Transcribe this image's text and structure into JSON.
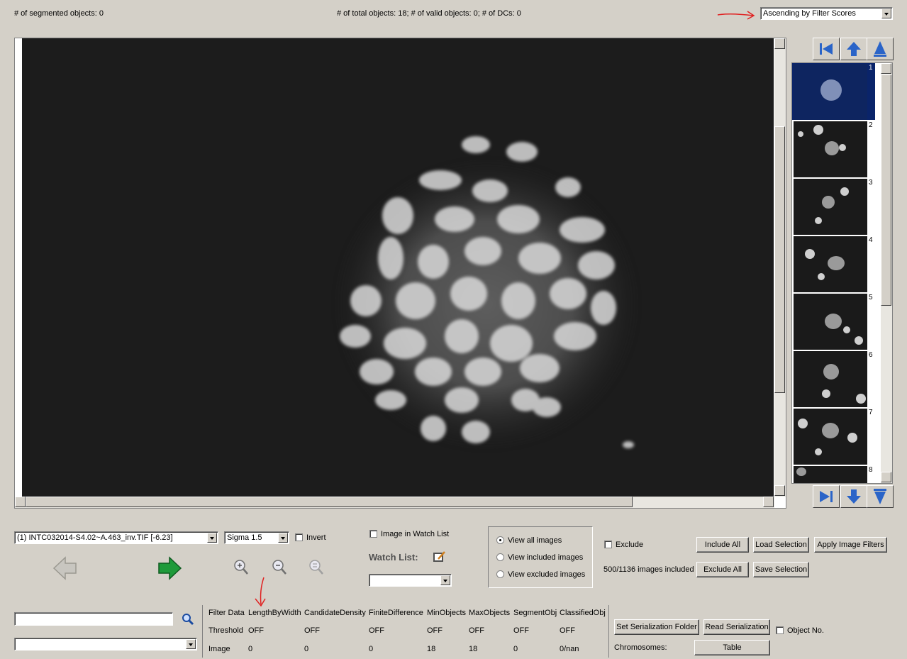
{
  "status": {
    "segmented": "# of segmented objects: 0",
    "totals": "# of total objects: 18; # of valid objects: 0; # of DCs: 0"
  },
  "sort": {
    "selected": "Ascending by Filter Scores"
  },
  "thumbnails": [
    {
      "num": "1"
    },
    {
      "num": "2"
    },
    {
      "num": "3"
    },
    {
      "num": "4"
    },
    {
      "num": "5"
    },
    {
      "num": "6"
    },
    {
      "num": "7"
    },
    {
      "num": "8"
    }
  ],
  "image_select": {
    "selected": "(1) INTC032014-S4.02~A.463_inv.TIF [-6.23]"
  },
  "sigma": {
    "selected": "Sigma 1.5"
  },
  "invert_label": "Invert",
  "watch": {
    "checkbox_label": "Image in Watch List",
    "list_label": "Watch List:"
  },
  "view_options": [
    "View all images",
    "View included images",
    "View excluded images"
  ],
  "exclude_label": "Exclude",
  "included_count": "500/1136 images included",
  "buttons": {
    "include_all": "Include All",
    "load_selection": "Load Selection",
    "apply_filters": "Apply Image Filters",
    "exclude_all": "Exclude All",
    "save_selection": "Save Selection",
    "set_serialization": "Set Serialization Folder",
    "read_serialization": "Read Serialization",
    "table": "Table"
  },
  "object_no_label": "Object No.",
  "chromosomes_label": "Chromosomes:",
  "filter_table": {
    "headers": [
      "Filter Data",
      "LengthByWidth",
      "CandidateDensity",
      "FiniteDifference",
      "MinObjects",
      "MaxObjects",
      "SegmentObj",
      "ClassifiedObj"
    ],
    "threshold": [
      "Threshold",
      "OFF",
      "OFF",
      "OFF",
      "OFF",
      "OFF",
      "OFF",
      "OFF"
    ],
    "image": [
      "Image",
      "0",
      "0",
      "0",
      "18",
      "18",
      "0",
      "0/nan"
    ]
  },
  "colors": {
    "annotation_red": "#e02020",
    "thumb_selected": "#0a246a",
    "green_arrow": "#1e9a3a"
  }
}
